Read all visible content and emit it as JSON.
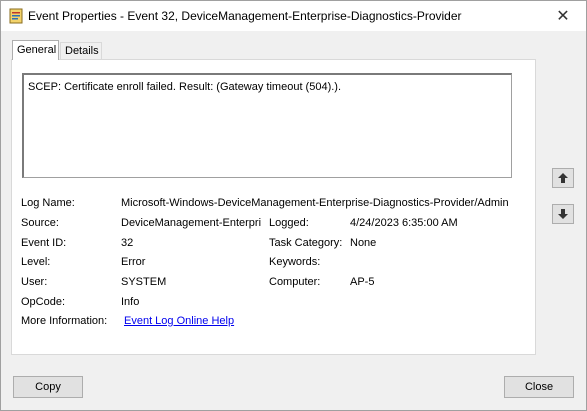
{
  "window": {
    "title": "Event Properties - Event 32, DeviceManagement-Enterprise-Diagnostics-Provider",
    "close_glyph": "✕"
  },
  "tabs": [
    {
      "label": "General",
      "active": true
    },
    {
      "label": "Details",
      "active": false
    }
  ],
  "description": "SCEP: Certificate enroll failed. Result: (Gateway timeout (504).).",
  "fields": {
    "log_name_label": "Log Name:",
    "log_name_value": "Microsoft-Windows-DeviceManagement-Enterprise-Diagnostics-Provider/Admin",
    "source_label": "Source:",
    "source_value": "DeviceManagement-Enterpri",
    "logged_label": "Logged:",
    "logged_value": "4/24/2023 6:35:00 AM",
    "event_id_label": "Event ID:",
    "event_id_value": "32",
    "task_category_label": "Task Category:",
    "task_category_value": "None",
    "level_label": "Level:",
    "level_value": "Error",
    "keywords_label": "Keywords:",
    "keywords_value": "",
    "user_label": "User:",
    "user_value": "SYSTEM",
    "computer_label": "Computer:",
    "computer_value": "AP-5",
    "opcode_label": "OpCode:",
    "opcode_value": "Info",
    "more_info_label": "More Information:",
    "more_info_link": "Event Log Online Help"
  },
  "buttons": {
    "copy": "Copy",
    "close": "Close"
  },
  "icons": {
    "title_icon": "event-viewer-icon",
    "up_arrow": "arrow-up-icon",
    "down_arrow": "arrow-down-icon"
  }
}
